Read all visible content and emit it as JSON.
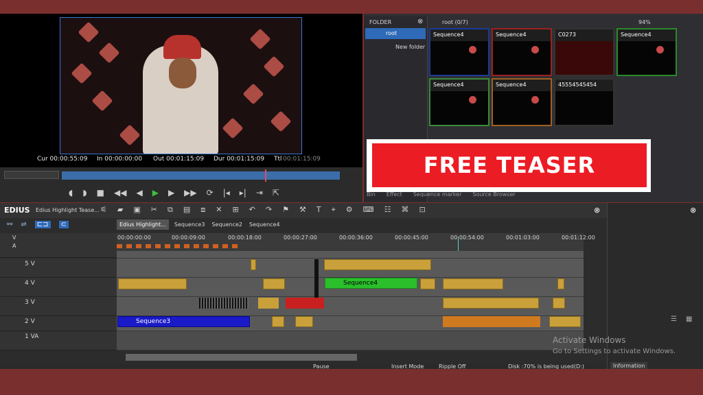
{
  "player": {
    "cur": "Cur 00:00:55:09",
    "in": "In 00:00:00:00",
    "out": "Out 00:01:15:09",
    "dur": "Dur 00:01:15:09",
    "ttl_label": "Ttl",
    "ttl": "00:01:15:09"
  },
  "bin": {
    "folder_label": "FOLDER",
    "root": "root",
    "new_folder": "New folder",
    "path": "root (0/7)",
    "zoom": "94%",
    "clips": [
      "Sequence4",
      "Sequence4",
      "C0273",
      "Sequence4",
      "Sequence4",
      "Sequence4",
      "45554545454"
    ],
    "tabs": [
      "Bin",
      "Effect",
      "Sequence marker",
      "Source Browser"
    ]
  },
  "overlay": {
    "teaser": "FREE TEASER"
  },
  "app": {
    "name": "EDIUS",
    "project": "Edius Highlight Tease..."
  },
  "timeline": {
    "tabs": [
      "Edius Highlight...",
      "Sequence3",
      "Sequence2",
      "Sequence4"
    ],
    "ruler": [
      "00:00:00:00",
      "00:00:09:00",
      "00:00:18:00",
      "00:00:27:00",
      "00:00:36:00",
      "00:00:45:00",
      "00:00:54:00",
      "00:01:03:00",
      "00:01:12:00"
    ],
    "tracks": [
      {
        "name": "V",
        "sub": "A"
      },
      {
        "name": "5 V"
      },
      {
        "name": "4 V"
      },
      {
        "name": "3 V"
      },
      {
        "name": "2 V"
      },
      {
        "name": "1 VA"
      }
    ],
    "labels": {
      "seq4": "Sequence4",
      "seq3": "Sequence3"
    }
  },
  "status": {
    "pause": "Pause",
    "insert": "Insert Mode",
    "ripple": "Ripple Off",
    "disk": "Disk :70% is being used(D:)"
  },
  "info": {
    "tab": "Information"
  },
  "watermark": {
    "line1": "Activate Windows",
    "line2": "Go to Settings to activate Windows."
  }
}
